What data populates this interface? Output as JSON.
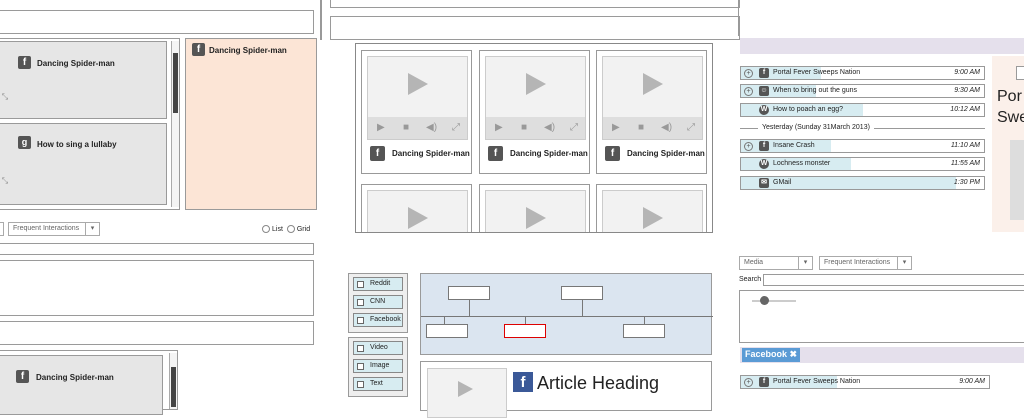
{
  "left_panel": {
    "cards": [
      {
        "icon": "f",
        "title": "Dancing Spider-man"
      },
      {
        "icon": "g",
        "title": "How to sing a lullaby"
      }
    ],
    "highlight_card": {
      "icon": "f",
      "title": "Dancing Spider-man"
    },
    "filter_dropdown": "Frequent Interactions",
    "view_list": "List",
    "view_grid": "Grid",
    "bottom_card": {
      "icon": "f",
      "title": "Dancing Spider-man"
    }
  },
  "video_grid": {
    "items": [
      {
        "title": "Dancing Spider-man"
      },
      {
        "title": "Dancing Spider-man"
      },
      {
        "title": "Dancing Spider-man"
      }
    ]
  },
  "filters": {
    "sources": [
      "Reddit",
      "CNN",
      "Facebook"
    ],
    "types": [
      "Video",
      "Image",
      "Text"
    ]
  },
  "article": {
    "heading": "Article Heading"
  },
  "feed": {
    "rows_top": [
      {
        "icon": "f",
        "text": "Portal Fever Sweeps Nation",
        "time": "9:00 AM",
        "plus": true
      },
      {
        "icon": "r",
        "text": "When to bring out the guns",
        "time": "9:30 AM",
        "plus": true
      },
      {
        "icon": "w",
        "text": "How to poach an egg?",
        "time": "10:12 AM",
        "plus": false
      }
    ],
    "date_divider": "Yesterday (Sunday 31March 2013)",
    "rows_bottom": [
      {
        "icon": "f",
        "text": "Insane Crash",
        "time": "11:10 AM",
        "plus": true
      },
      {
        "icon": "w",
        "text": "Lochness monster",
        "time": "11:55 AM",
        "plus": false
      },
      {
        "icon": "m",
        "text": "GMail",
        "time": "1:30 PM",
        "plus": false
      }
    ],
    "preview_text_1": "Por",
    "preview_text_2": "Swe"
  },
  "search_panel": {
    "media_dropdown": "Media",
    "interactions_dropdown": "Frequent Interactions",
    "search_label": "Search",
    "tag": "Facebook",
    "row": {
      "icon": "f",
      "text": "Portal Fever Sweeps Nation",
      "time": "9:00 AM"
    }
  }
}
